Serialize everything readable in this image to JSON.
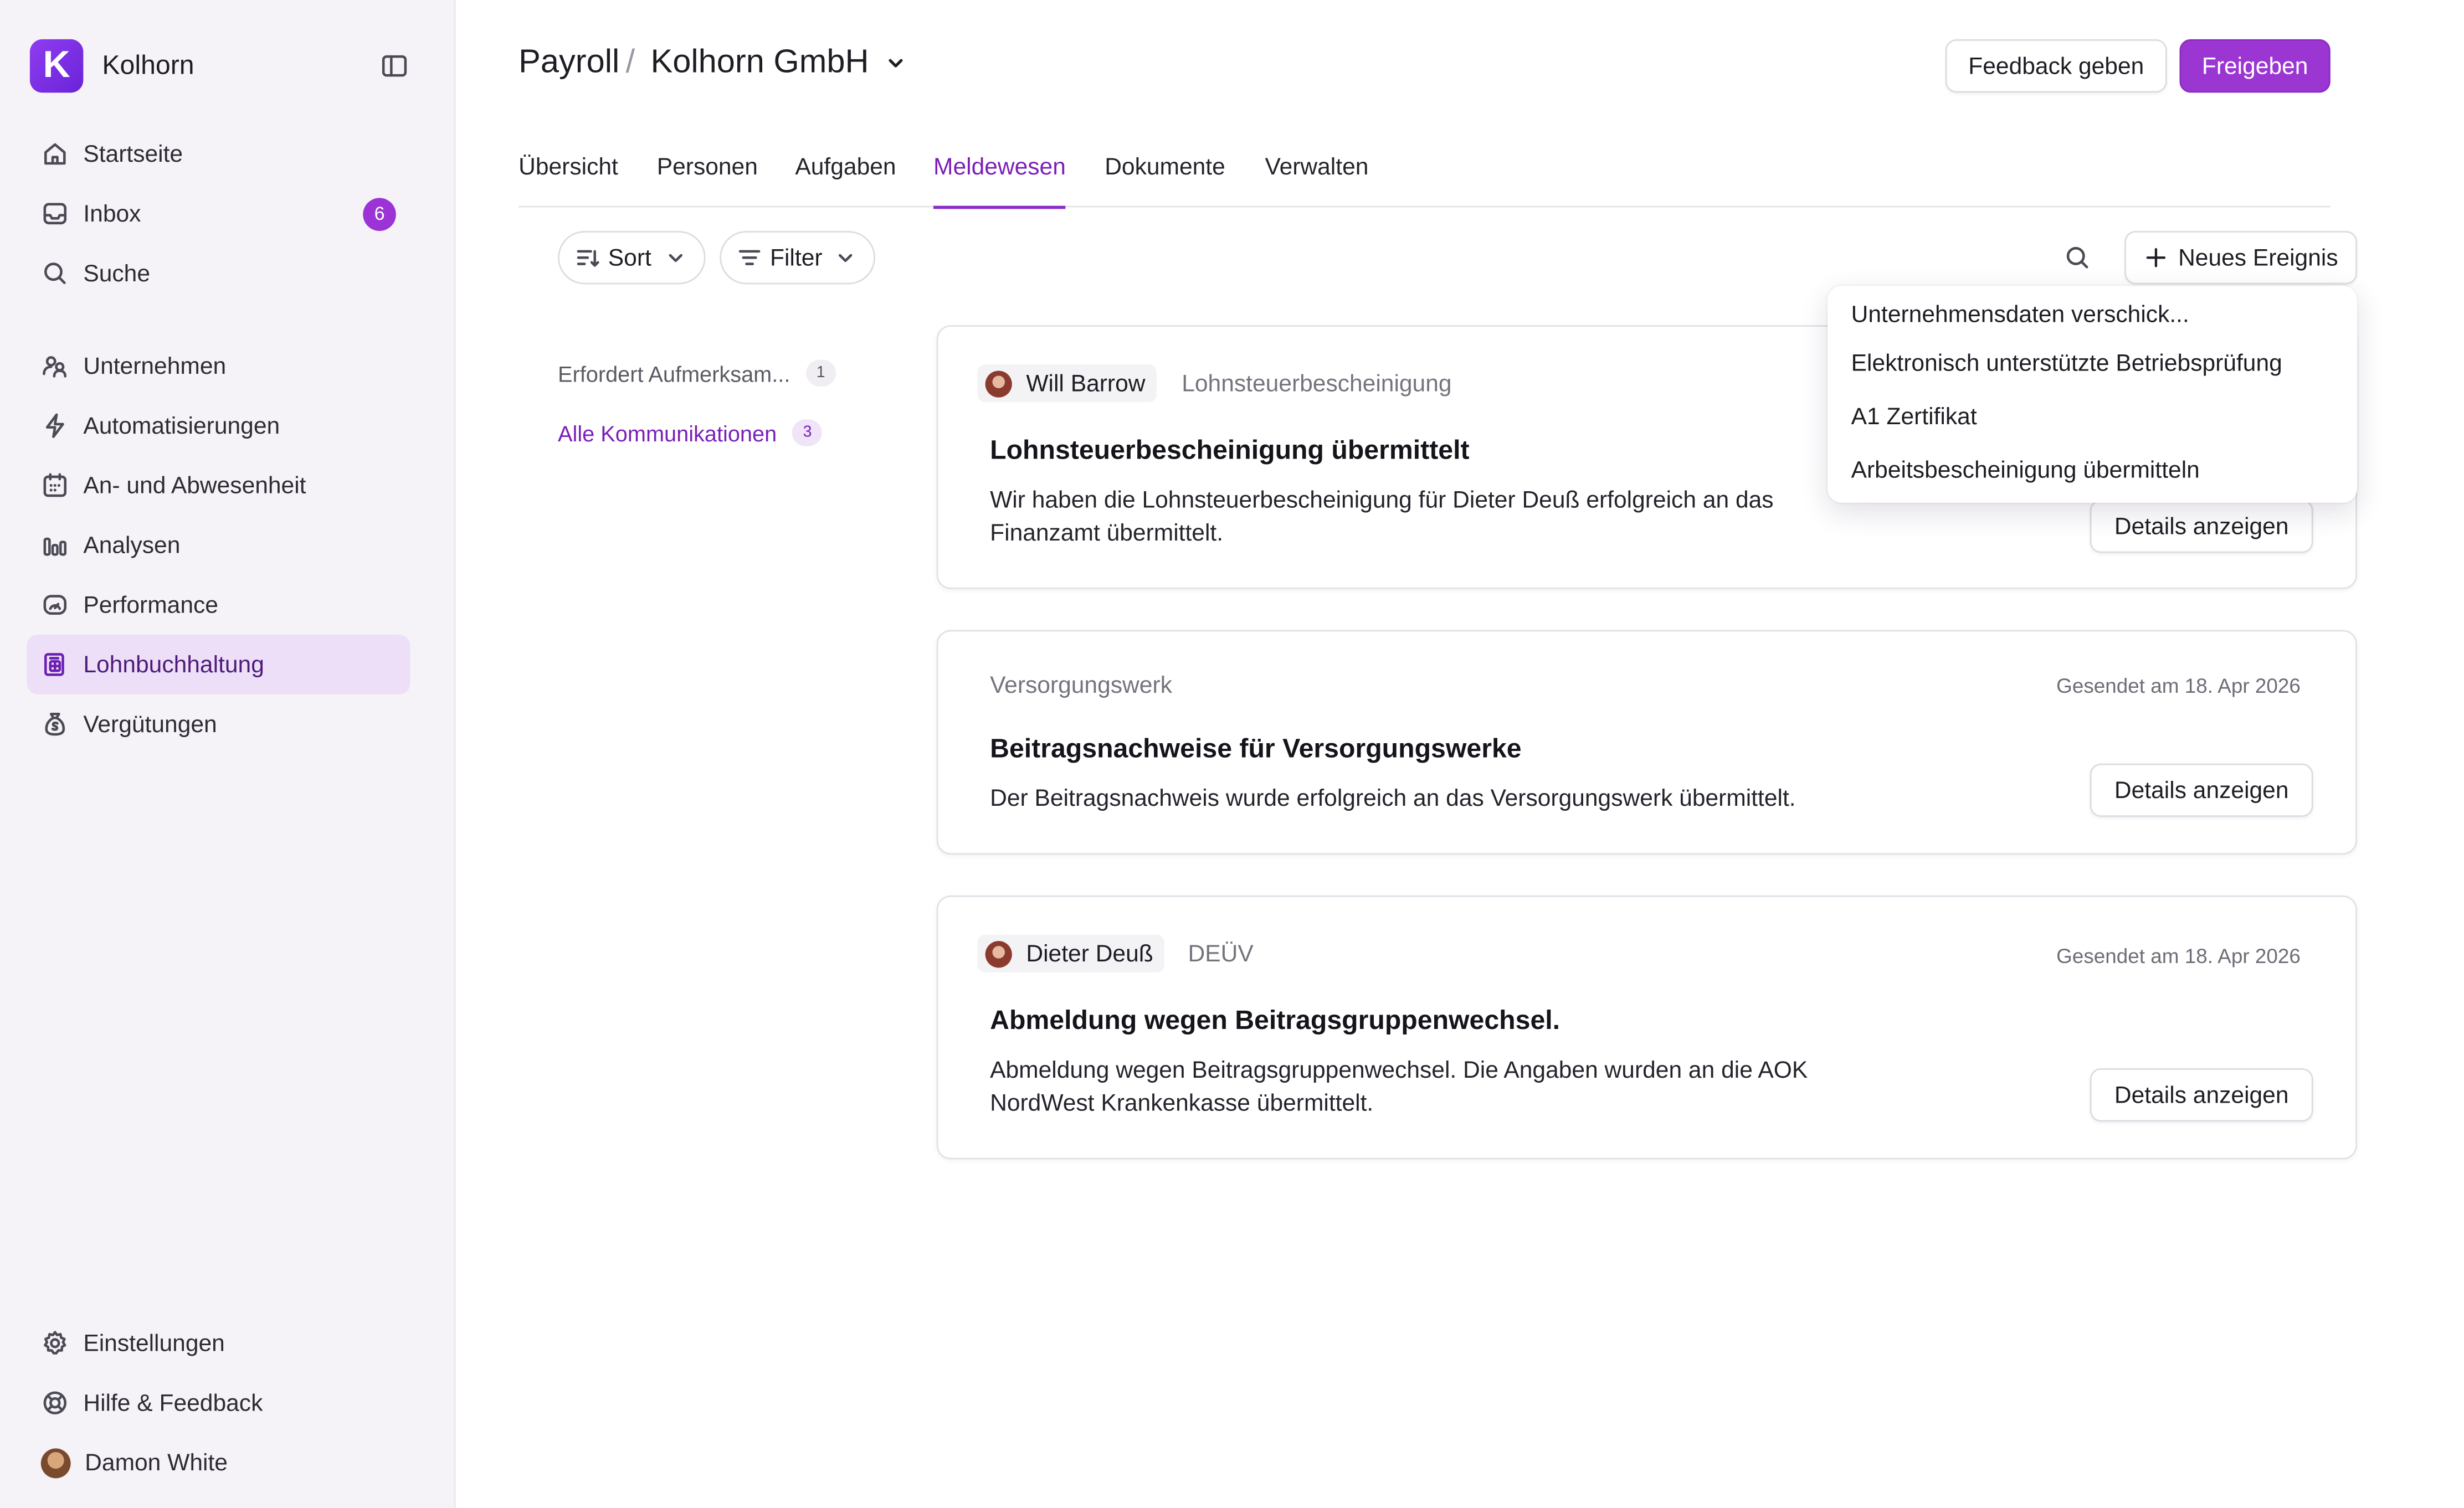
{
  "app": {
    "name": "Kolhorn"
  },
  "sidebar": {
    "items": [
      {
        "label": "Startseite"
      },
      {
        "label": "Inbox",
        "badge": "6"
      },
      {
        "label": "Suche"
      },
      {
        "label": "Unternehmen"
      },
      {
        "label": "Automatisierungen"
      },
      {
        "label": "An- und Abwesenheit"
      },
      {
        "label": "Analysen"
      },
      {
        "label": "Performance"
      },
      {
        "label": "Lohnbuchhaltung"
      },
      {
        "label": "Vergütungen"
      }
    ],
    "bottom": [
      {
        "label": "Einstellungen"
      },
      {
        "label": "Hilfe & Feedback"
      },
      {
        "label": "Damon White"
      }
    ]
  },
  "header": {
    "section": "Payroll",
    "separator": "/",
    "company": "Kolhorn GmbH",
    "feedback_label": "Feedback geben",
    "release_label": "Freigeben"
  },
  "tabs": [
    "Übersicht",
    "Personen",
    "Aufgaben",
    "Meldewesen",
    "Dokumente",
    "Verwalten"
  ],
  "active_tab": "Meldewesen",
  "toolbar": {
    "sort_label": "Sort",
    "filter_label": "Filter",
    "new_event_label": "Neues Ereignis"
  },
  "filters": [
    {
      "label": "Erfordert Aufmerksam...",
      "count": "1"
    },
    {
      "label": "Alle Kommunikationen",
      "count": "3"
    }
  ],
  "dropdown": {
    "items": [
      "Unternehmensdaten verschick...",
      "Elektronisch unterstützte Betriebsprüfung",
      "A1 Zertifikat",
      "Arbeitsbescheinigung übermitteln"
    ]
  },
  "cards": [
    {
      "person": "Will Barrow",
      "category": "Lohnsteuerbescheinigung",
      "title": "Lohnsteuerbescheinigung übermittelt",
      "body": "Wir haben die Lohnsteuerbescheinigung für Dieter Deuß erfolgreich an das Finanzamt übermittelt.",
      "button": "Details anzeigen"
    },
    {
      "category": "Versorgungswerk",
      "date": "Gesendet am 18. Apr 2026",
      "title": "Beitragsnachweise für Versorgungswerke",
      "body": "Der Beitragsnachweis wurde erfolgreich an das Versorgungswerk übermittelt.",
      "button": "Details anzeigen"
    },
    {
      "person": "Dieter Deuß",
      "category": "DEÜV",
      "date": "Gesendet am 18. Apr 2026",
      "title": "Abmeldung wegen Beitragsgruppenwechsel.",
      "body": "Abmeldung wegen Beitragsgruppenwechsel. Die Angaben wurden an die AOK NordWest Krankenkasse übermittelt.",
      "button": "Details anzeigen"
    }
  ],
  "colors": {
    "accent": "#9b36d2",
    "active_bg": "#eddff8",
    "sidebar_bg": "#f5f3f7"
  }
}
